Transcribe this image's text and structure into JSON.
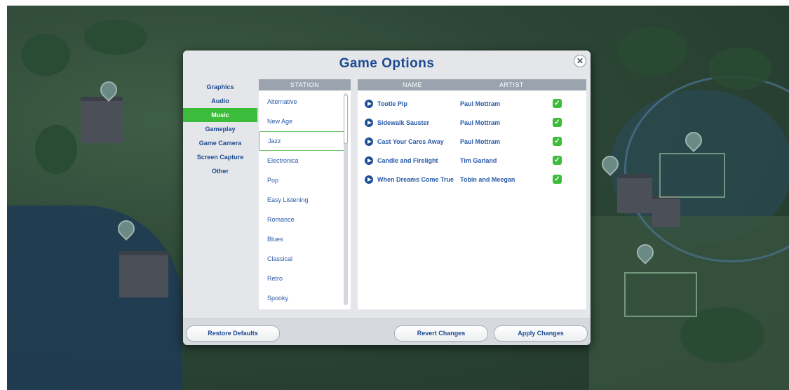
{
  "dialog": {
    "title": "Game Options",
    "close_label": "✕"
  },
  "nav": {
    "items": [
      {
        "label": "Graphics"
      },
      {
        "label": "Audio"
      },
      {
        "label": "Music"
      },
      {
        "label": "Gameplay"
      },
      {
        "label": "Game Camera"
      },
      {
        "label": "Screen Capture"
      },
      {
        "label": "Other"
      }
    ],
    "active": "Music"
  },
  "station": {
    "header": "STATION",
    "items": [
      "Alternative",
      "New Age",
      "Jazz",
      "Electronica",
      "Pop",
      "Easy Listening",
      "Romance",
      "Blues",
      "Classical",
      "Retro",
      "Spooky"
    ],
    "selected": "Jazz"
  },
  "tracks": {
    "columns": {
      "name": "NAME",
      "artist": "ARTIST"
    },
    "rows": [
      {
        "name": "Tootle Pip",
        "artist": "Paul Mottram",
        "checked": true
      },
      {
        "name": "Sidewalk Sauster",
        "artist": "Paul Mottram",
        "checked": true
      },
      {
        "name": "Cast Your Cares Away",
        "artist": "Paul Mottram",
        "checked": true
      },
      {
        "name": "Candle and Firelight",
        "artist": "Tim Garland",
        "checked": true
      },
      {
        "name": "When Dreams Come True",
        "artist": "Tobin and Meegan",
        "checked": true
      }
    ],
    "check_glyph": "✓"
  },
  "footer": {
    "restore_label": "Restore Defaults",
    "revert_label": "Revert Changes",
    "apply_label": "Apply Changes"
  },
  "colors": {
    "accent_green": "#3dbb3a",
    "title_blue": "#1c4a91",
    "header_gray": "#9aa3ae"
  }
}
